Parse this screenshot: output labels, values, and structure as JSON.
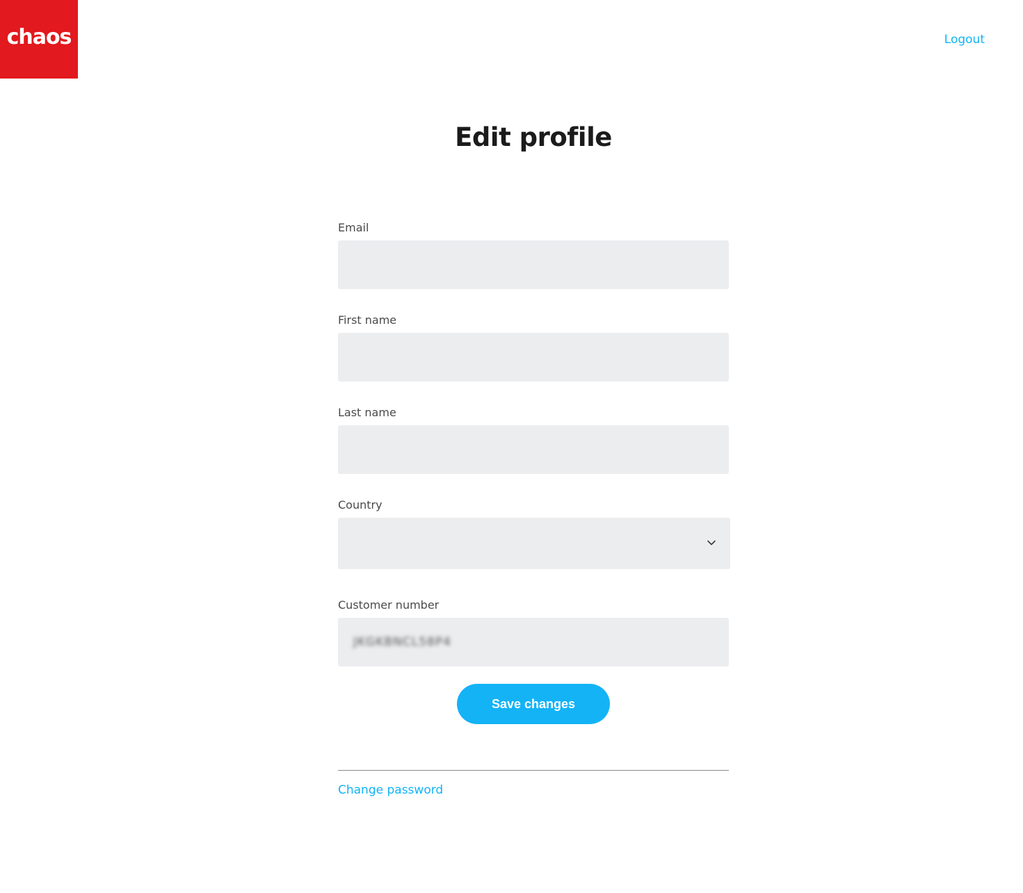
{
  "header": {
    "logo_text": "chaos",
    "logout_label": "Logout"
  },
  "page": {
    "title": "Edit profile"
  },
  "form": {
    "email": {
      "label": "Email",
      "value": ""
    },
    "first_name": {
      "label": "First name",
      "value": ""
    },
    "last_name": {
      "label": "Last name",
      "value": ""
    },
    "country": {
      "label": "Country",
      "value": ""
    },
    "customer_number": {
      "label": "Customer number",
      "value": "JKGKBNCL58P4"
    }
  },
  "actions": {
    "save_label": "Save changes",
    "change_password_label": "Change password"
  },
  "colors": {
    "brand_red": "#e2191e",
    "accent_blue": "#14b3f6",
    "input_bg": "#ecedef"
  },
  "icons": {
    "country_dropdown": "chevron-down-icon"
  }
}
